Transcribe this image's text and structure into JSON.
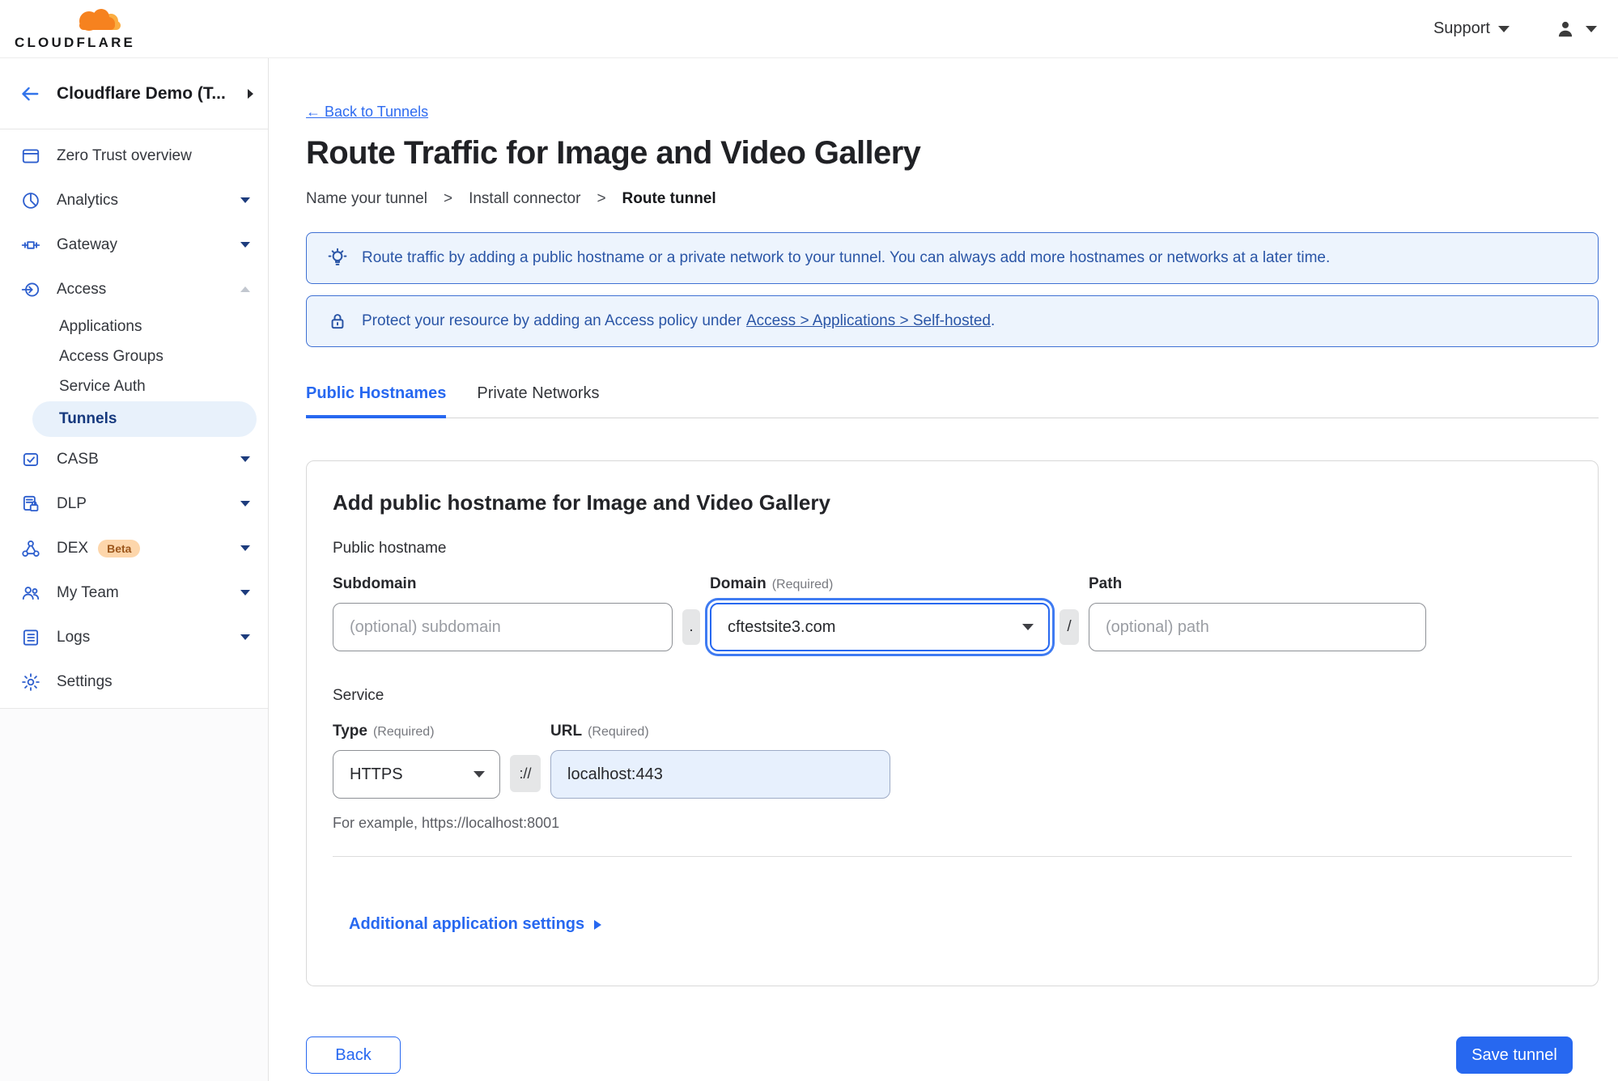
{
  "topbar": {
    "brand": "CLOUDFLARE",
    "support_label": "Support"
  },
  "sidebar": {
    "account_name": "Cloudflare Demo (T...",
    "items": [
      {
        "label": "Zero Trust overview",
        "icon": "overview-icon"
      },
      {
        "label": "Analytics",
        "icon": "analytics-icon",
        "caret": "down"
      },
      {
        "label": "Gateway",
        "icon": "gateway-icon",
        "caret": "down"
      },
      {
        "label": "Access",
        "icon": "access-icon",
        "caret": "up",
        "expanded": true
      },
      {
        "label": "Applications",
        "sub": true
      },
      {
        "label": "Access Groups",
        "sub": true
      },
      {
        "label": "Service Auth",
        "sub": true
      },
      {
        "label": "Tunnels",
        "sub": true,
        "selected": true
      },
      {
        "label": "CASB",
        "icon": "casb-icon",
        "caret": "down"
      },
      {
        "label": "DLP",
        "icon": "dlp-icon",
        "caret": "down"
      },
      {
        "label": "DEX",
        "icon": "dex-icon",
        "badge": "Beta",
        "caret": "down"
      },
      {
        "label": "My Team",
        "icon": "team-icon",
        "caret": "down"
      },
      {
        "label": "Logs",
        "icon": "logs-icon",
        "caret": "down"
      },
      {
        "label": "Settings",
        "icon": "settings-icon"
      }
    ]
  },
  "page": {
    "back_link": "← Back to Tunnels",
    "title": "Route Traffic for Image and Video Gallery",
    "step_separator": ">",
    "steps": [
      "Name your tunnel",
      "Install connector",
      "Route tunnel"
    ],
    "banners": [
      {
        "icon": "lightbulb-icon",
        "text": "Route traffic by adding a public hostname or a private network to your tunnel. You can always add more hostnames or networks at a later time."
      },
      {
        "icon": "lock-icon",
        "text": "Protect your resource by adding an Access policy under",
        "link_text": "Access > Applications > Self-hosted",
        "suffix": "."
      }
    ],
    "tabs": [
      {
        "label": "Public Hostnames",
        "active": true
      },
      {
        "label": "Private Networks",
        "active": false
      }
    ]
  },
  "form": {
    "card_title": "Add public hostname for Image and Video Gallery",
    "public_hostname_section": "Public hostname",
    "subdomain_label": "Subdomain",
    "subdomain_placeholder": "(optional) subdomain",
    "dot_separator": ".",
    "domain_label": "Domain",
    "required_hint": "(Required)",
    "domain_value": "cftestsite3.com",
    "slash_separator": "/",
    "path_label": "Path",
    "path_placeholder": "(optional) path",
    "service_section": "Service",
    "type_label": "Type",
    "type_value": "HTTPS",
    "scheme_separator": "://",
    "url_label": "URL",
    "url_value": "localhost:443",
    "url_example": "For example, https://localhost:8001",
    "additional_settings_label": "Additional application settings"
  },
  "actions": {
    "back_label": "Back",
    "save_label": "Save tunnel"
  },
  "icons": {
    "support-caret": "▼",
    "user-caret": "▼",
    "user-icon": "person-silhouette",
    "sidebar-back-arrow": "←",
    "sidebar-expand": "▸",
    "nav-chevron-down": "▾",
    "nav-chevron-up": "▴",
    "select-caret": "▾",
    "additional-settings-caret": "▶",
    "banner-1": "lightbulb",
    "banner-2": "lock"
  },
  "colors": {
    "accent": "#2768f0",
    "banner_bg": "#edf4fd",
    "banner_border": "#3e70d3",
    "banner_text": "#2a55a6",
    "selected_item_bg": "#e8f1fb",
    "selected_item_text": "#16397e",
    "beta_badge_bg": "#fdd6ab",
    "beta_badge_text": "#9c561b",
    "url_field_bg": "#e7f0fd",
    "logo_orange": "#f6821f",
    "logo_orange_light": "#fbad41"
  }
}
